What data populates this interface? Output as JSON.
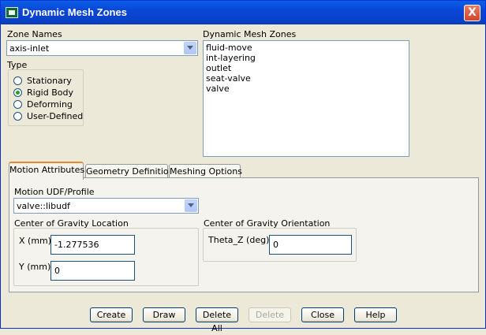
{
  "window": {
    "title": "Dynamic Mesh Zones",
    "close_glyph": "X"
  },
  "zone_names": {
    "label": "Zone Names",
    "value": "axis-inlet"
  },
  "type": {
    "label": "Type",
    "options": [
      {
        "label": "Stationary",
        "selected": false
      },
      {
        "label": "Rigid Body",
        "selected": true
      },
      {
        "label": "Deforming",
        "selected": false
      },
      {
        "label": "User-Defined",
        "selected": false
      }
    ]
  },
  "dynamic_mesh_zones": {
    "label": "Dynamic Mesh Zones",
    "items": [
      "fluid-move",
      "int-layering",
      "outlet",
      "seat-valve",
      "valve"
    ]
  },
  "tabs": [
    "Motion Attributes",
    "Geometry Definition",
    "Meshing Options"
  ],
  "motion": {
    "label": "Motion UDF/Profile",
    "value": "valve::libudf"
  },
  "cog_location": {
    "label": "Center of Gravity Location",
    "x_label": "X (mm)",
    "x_value": "-1.277536",
    "y_label": "Y (mm)",
    "y_value": "0"
  },
  "cog_orientation": {
    "label": "Center of Gravity Orientation",
    "theta_label": "Theta_Z (deg)",
    "theta_value": "0"
  },
  "buttons": {
    "create": "Create",
    "draw": "Draw",
    "delete_all": "Delete All",
    "delete": "Delete",
    "close": "Close",
    "help": "Help"
  }
}
